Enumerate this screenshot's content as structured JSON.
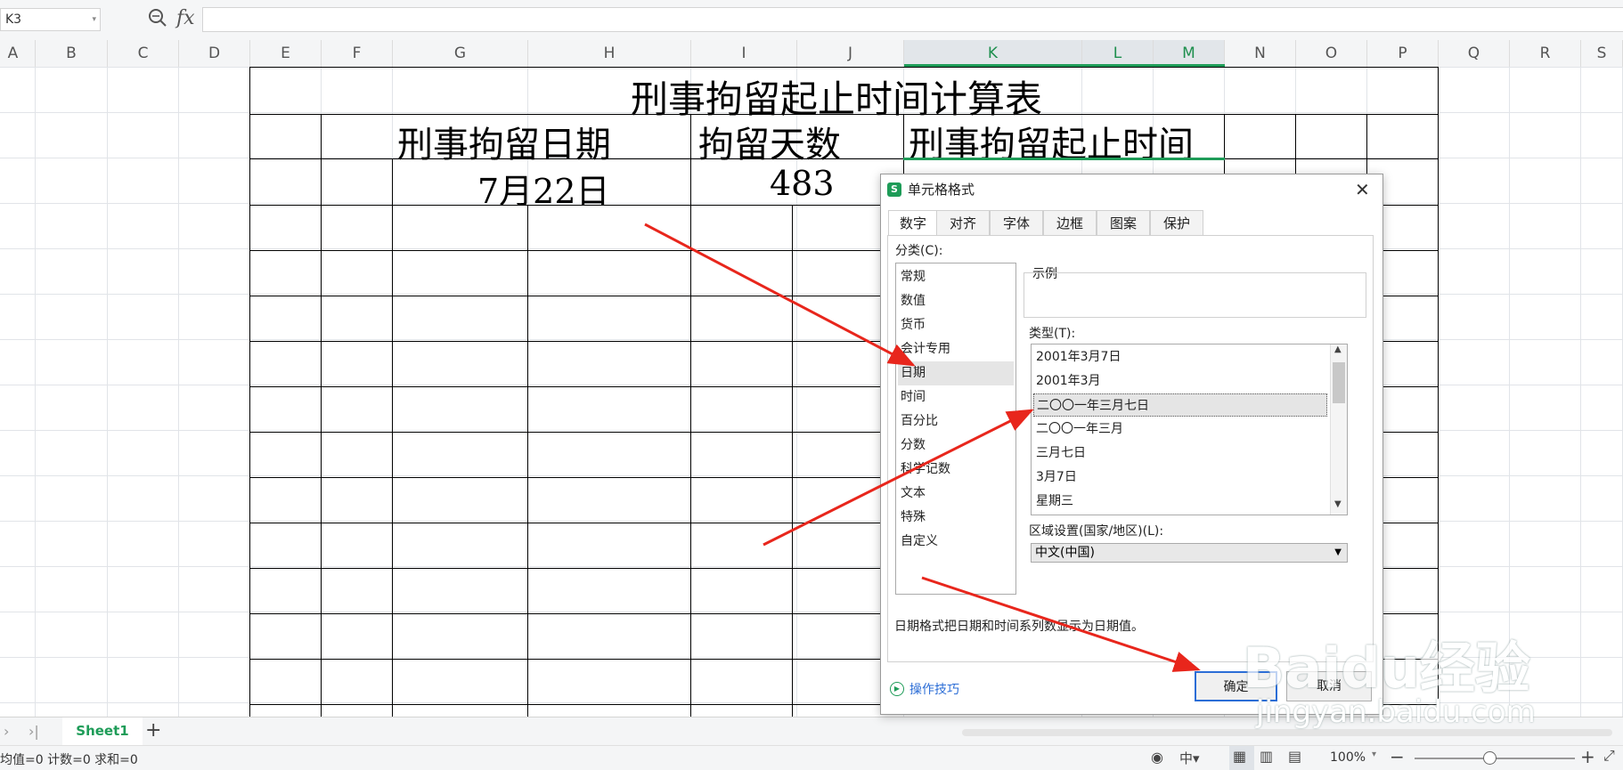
{
  "formula_bar": {
    "cell_ref": "K3",
    "fx_label": "fx",
    "formula": ""
  },
  "columns": [
    "A",
    "B",
    "C",
    "D",
    "E",
    "F",
    "G",
    "H",
    "I",
    "J",
    "K",
    "L",
    "M",
    "N",
    "O",
    "P",
    "Q",
    "R",
    "S"
  ],
  "selected_column": "K",
  "sheet": {
    "title": "刑事拘留起止时间计算表",
    "header_date": "刑事拘留日期",
    "header_days": "拘留天数",
    "header_range": "刑事拘留起止时间",
    "date_value": "7月22日",
    "days_value": "483"
  },
  "tabs_bar": {
    "sheet_name": "Sheet1",
    "add_label": "+"
  },
  "status_bar": {
    "summary": "均值=0  计数=0  求和=0",
    "zoom": "100%"
  },
  "dialog": {
    "title": "单元格格式",
    "tabs": [
      "数字",
      "对齐",
      "字体",
      "边框",
      "图案",
      "保护"
    ],
    "active_tab": "数字",
    "category_label": "分类(C):",
    "categories": [
      "常规",
      "数值",
      "货币",
      "会计专用",
      "日期",
      "时间",
      "百分比",
      "分数",
      "科学记数",
      "文本",
      "特殊",
      "自定义"
    ],
    "selected_category": "日期",
    "sample_label": "示例",
    "type_label": "类型(T):",
    "types": [
      "2001年3月7日",
      "2001年3月",
      "二〇〇一年三月七日",
      "二〇〇一年三月",
      "三月七日",
      "3月7日",
      "星期三"
    ],
    "selected_type": "二〇〇一年三月七日",
    "locale_label": "区域设置(国家/地区)(L):",
    "locale_value": "中文(中国)",
    "description": "日期格式把日期和时间系列数显示为日期值。",
    "tips_label": "操作技巧",
    "ok_label": "确定",
    "cancel_label": "取消"
  },
  "watermark": {
    "brand": "Baidu经验",
    "url": "jingyan.baidu.com"
  },
  "colors": {
    "accent_green": "#1e9c58",
    "arrow_red": "#e8261c",
    "ok_border": "#2b6dd6"
  }
}
